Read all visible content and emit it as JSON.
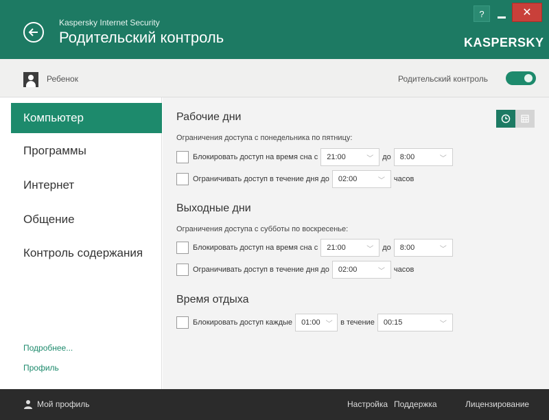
{
  "header": {
    "product": "Kaspersky Internet Security",
    "title": "Родительский контроль",
    "logo": "KASPERSKY",
    "help": "?",
    "close": "✕",
    "bg_color": "#1d7a63"
  },
  "profile_bar": {
    "child_name": "Ребенок",
    "parental_control_label": "Родительский контроль",
    "parental_control_enabled": true
  },
  "sidebar": {
    "items": [
      {
        "label": "Компьютер",
        "active": true
      },
      {
        "label": "Программы",
        "active": false
      },
      {
        "label": "Интернет",
        "active": false
      },
      {
        "label": "Общение",
        "active": false
      },
      {
        "label": "Контроль содержания",
        "active": false
      }
    ],
    "more_link": "Подробнее...",
    "profile_link": "Профиль"
  },
  "content": {
    "workdays": {
      "title": "Рабочие дни",
      "desc": "Ограничения доступа с понедельника по пятницу:",
      "sleep_label": "Блокировать доступ на время сна с",
      "sleep_from": "21:00",
      "to_label": "до",
      "sleep_to": "8:00",
      "limit_label": "Ограничивать доступ в течение дня до",
      "limit_value": "02:00",
      "hours_label": "часов"
    },
    "weekend": {
      "title": "Выходные дни",
      "desc": "Ограничения доступа с субботы по воскресенье:",
      "sleep_label": "Блокировать доступ на время сна с",
      "sleep_from": "21:00",
      "to_label": "до",
      "sleep_to": "8:00",
      "limit_label": "Ограничивать доступ в течение дня до",
      "limit_value": "02:00",
      "hours_label": "часов"
    },
    "rest": {
      "title": "Время отдыха",
      "block_label": "Блокировать доступ каждые",
      "every_value": "01:00",
      "during_label": "в течение",
      "during_value": "00:15"
    }
  },
  "footer": {
    "my_profile": "Мой профиль",
    "settings": "Настройка",
    "support": "Поддержка",
    "licensing": "Лицензирование"
  }
}
